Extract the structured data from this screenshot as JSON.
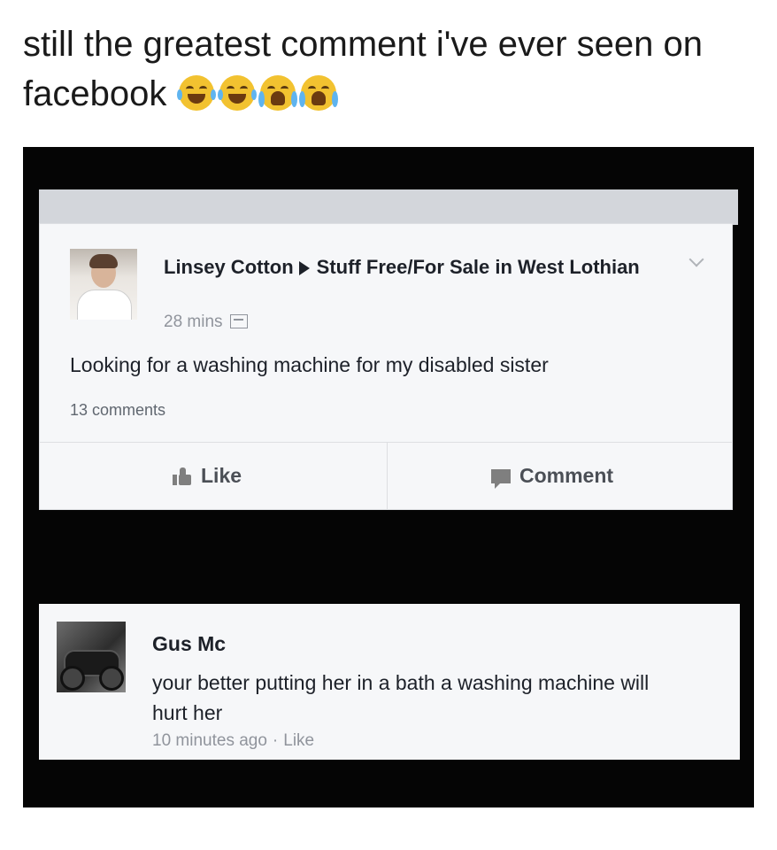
{
  "caption": {
    "text": "still the greatest comment i've ever seen on facebook",
    "emojis": [
      "face-with-tears-of-joy-icon",
      "face-with-tears-of-joy-icon",
      "loudly-crying-face-icon",
      "loudly-crying-face-icon"
    ]
  },
  "post": {
    "author": "Linsey Cotton",
    "group": "Stuff Free/For Sale in West Lothian",
    "time": "28 mins",
    "text": "Looking for a washing machine for my disabled sister",
    "comments_count": "13 comments",
    "like_label": "Like",
    "comment_label": "Comment"
  },
  "comment": {
    "author": "Gus Mc",
    "text": "your better putting her in a bath a washing machine will hurt her",
    "time": "10 minutes ago",
    "like_label": "Like"
  },
  "colors": {
    "background": "#ffffff",
    "screen": "#050505",
    "card": "#f6f7f9",
    "text": "#1d2129",
    "meta": "#90949c",
    "emoji": "#f2c230"
  }
}
